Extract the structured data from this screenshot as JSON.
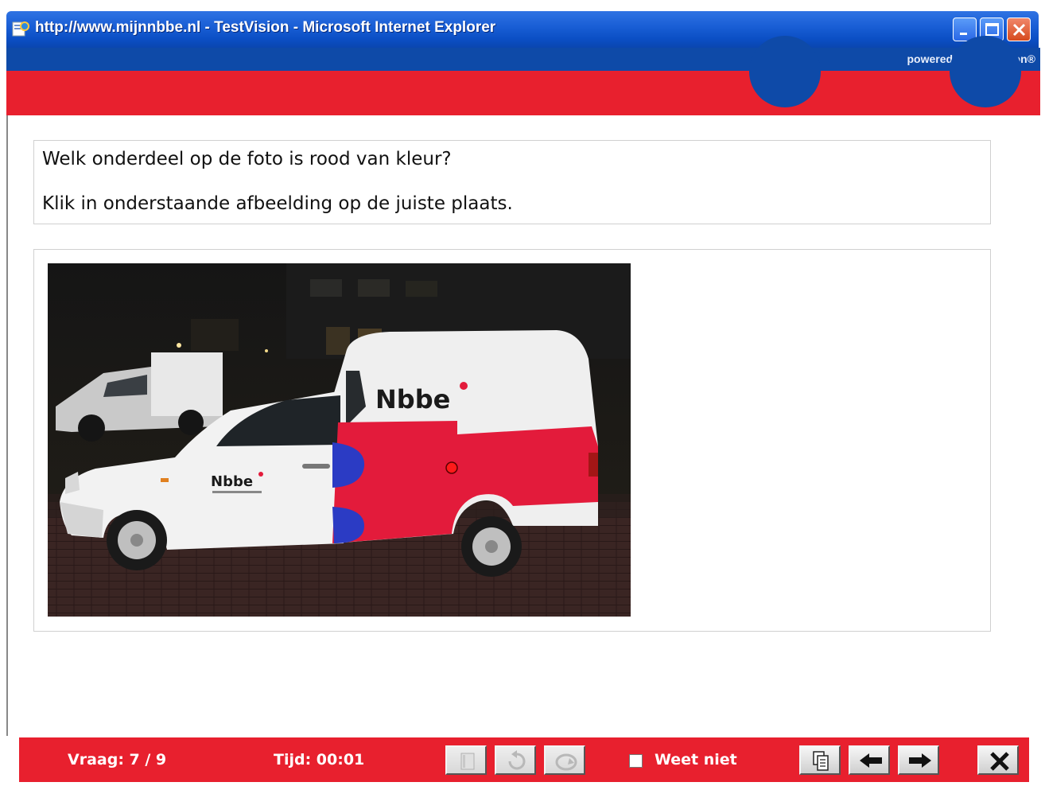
{
  "window": {
    "title": "http://www.mijnnbbe.nl - TestVision - Microsoft Internet Explorer",
    "controls": [
      "minimize-icon",
      "maximize-icon",
      "close-icon"
    ]
  },
  "header": {
    "powered_by": "powered by TestVision®",
    "band_color": "#e8202e",
    "accent_color": "#0e4aa8"
  },
  "question": {
    "line1": "Welk onderdeel op de foto is rood van kleur?",
    "line2": "Klik in onderstaande afbeelding op de juiste plaats."
  },
  "image": {
    "alt_subject": "white van with red and blue Nbbe livery at night",
    "brand_text": "Nbbe",
    "click_marker": "red-dot"
  },
  "footer": {
    "question_counter": "Vraag: 7 / 9",
    "time": "Tijd: 00:01",
    "dont_know_label": "Weet niet",
    "dont_know_checked": false,
    "buttons": [
      "book-icon",
      "undo-icon",
      "redo-icon",
      "overview-icon",
      "prev-arrow-icon",
      "next-arrow-icon",
      "close-x-icon"
    ]
  }
}
